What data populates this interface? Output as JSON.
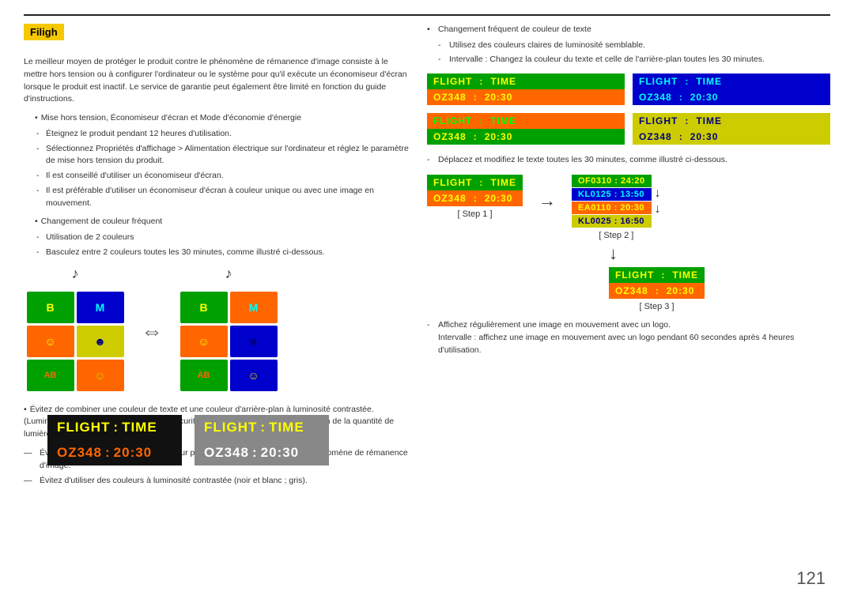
{
  "page": {
    "number": "121"
  },
  "heading": {
    "label": "Filigh"
  },
  "left": {
    "intro_text": "Le meilleur moyen de protéger le produit contre le phénomène de rémanence d'image consiste à le mettre hors tension ou à configurer l'ordinateur ou le système pour qu'il exécute un économiseur d'écran lorsque le produit est inactif. Le service de garantie peut également être limité en fonction du guide d'instructions.",
    "bullet1": "Mise hors tension, Économiseur d'écran et Mode d'économie d'énergie",
    "sub1_1": "Éteignez le produit pendant 12 heures d'utilisation.",
    "sub1_2": "Sélectionnez Propriétés d'affichage > Alimentation électrique sur l'ordinateur et réglez le paramètre de mise hors tension du produit.",
    "sub1_3": "Il est conseillé d'utiliser un économiseur d'écran.",
    "sub1_4": "Il est préférable d'utiliser un économiseur d'écran à couleur unique ou avec une image en mouvement.",
    "bullet2": "Changement de couleur fréquent",
    "sub2_1": "Utilisation de 2 couleurs",
    "sub2_2": "Basculez entre 2 couleurs toutes les 30 minutes, comme illustré ci-dessous.",
    "avoid_text1": "Évitez de combiner une couleur de texte et une couleur d'arrière-plan à luminosité contrastée. (Luminosité : indique la luminosité ou l'obscurité d'une couleur, qui varie en fonction de la quantité de lumière émise.)",
    "em_text1": "Évitez d'utiliser du gris, car cette couleur peut contribuer à l'apparition du phénomène de rémanence d'image.",
    "em_text2": "Évitez d'utiliser des couleurs à luminosité contrastée (noir et blanc ; gris)."
  },
  "right": {
    "bullet1": "Changement fréquent de couleur de texte",
    "sub1_1": "Utilisez des couleurs claires de luminosité semblable.",
    "sub1_2": "Intervalle : Changez la couleur du texte et celle de l'arrière-plan toutes les 30 minutes.",
    "move_text": "Déplacez et modifiez le texte toutes les 30 minutes, comme illustré ci-dessous.",
    "step1_label": "[ Step 1 ]",
    "step2_label": "[ Step 2 ]",
    "step3_label": "[ Step 3 ]",
    "logo_text": "Affichez régulièrement une image en mouvement avec un logo.",
    "logo_sub": "Intervalle : affichez une image en mouvement avec un logo pendant 60 secondes après 4 heures d'utilisation."
  },
  "flight_displays": {
    "label": "FLIGHT",
    "colon": ":",
    "time": "TIME",
    "flight_no": "OZ348",
    "time_val": "20:30",
    "step2_flights": [
      {
        "code": "OF0310",
        "time": "24:20",
        "bg": "#00a000",
        "color": "#ffff00"
      },
      {
        "code": "KL0125",
        "time": "13:50",
        "bg": "#0000cc",
        "color": "#00ffff"
      },
      {
        "code": "EA0110",
        "time": "20:30",
        "bg": "#ff6600",
        "color": "#ffff00"
      },
      {
        "code": "KL0025",
        "time": "16:50",
        "bg": "#cccc00",
        "color": "#000080"
      }
    ]
  },
  "icons": {
    "grid1": [
      {
        "symbol": "B",
        "bg": "#00a000",
        "color": "#ffff00"
      },
      {
        "symbol": "M",
        "bg": "#0000cc",
        "color": "#00ffff"
      },
      {
        "symbol": "☺",
        "bg": "#ff6600",
        "color": "#ffff00"
      },
      {
        "symbol": "☻",
        "bg": "#cccc00",
        "color": "#000080"
      },
      {
        "symbol": "AB",
        "bg": "#00a000",
        "color": "#ff6600"
      },
      {
        "symbol": "☺",
        "bg": "#ff6600",
        "color": "#cccc00"
      }
    ],
    "grid2": [
      {
        "symbol": "B",
        "bg": "#00a000",
        "color": "#ffff00"
      },
      {
        "symbol": "M",
        "bg": "#ff6600",
        "color": "#00ffff"
      },
      {
        "symbol": "☺",
        "bg": "#ff6600",
        "color": "#ffff00"
      },
      {
        "symbol": "☻",
        "bg": "#0000cc",
        "color": "#000080"
      },
      {
        "symbol": "AB",
        "bg": "#00a000",
        "color": "#ff6600"
      },
      {
        "symbol": "☺",
        "bg": "#0000cc",
        "color": "#cccc00"
      }
    ]
  }
}
